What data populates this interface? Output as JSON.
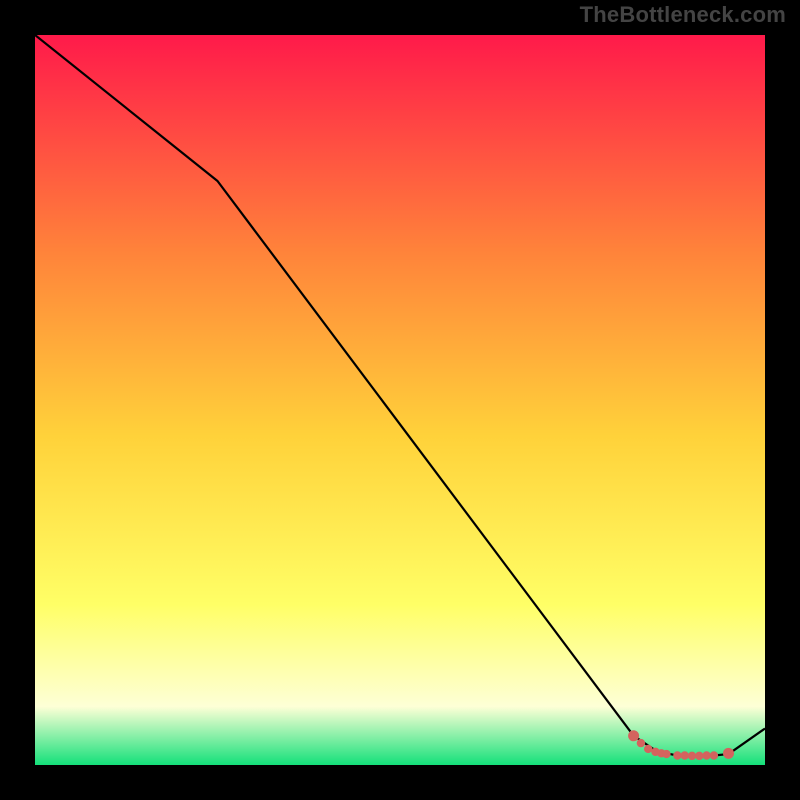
{
  "watermark": "TheBottleneck.com",
  "colors": {
    "gradient_top": "#ff1a4a",
    "gradient_mid_upper": "#ff843a",
    "gradient_mid": "#ffd23a",
    "gradient_mid_lower": "#ffff66",
    "gradient_lower": "#fdffd6",
    "gradient_bottom": "#14e07a",
    "line": "#000000",
    "marker": "#d4635e",
    "background": "#000000"
  },
  "chart_data": {
    "type": "line",
    "title": "",
    "xlabel": "",
    "ylabel": "",
    "xlim": [
      0,
      100
    ],
    "ylim": [
      0,
      100
    ],
    "series": [
      {
        "name": "bottleneck-curve",
        "x": [
          0,
          25,
          82,
          85,
          87,
          88,
          89,
          90,
          91,
          92,
          93,
          95,
          100
        ],
        "y": [
          100,
          80,
          4,
          2,
          1.5,
          1.3,
          1.2,
          1.2,
          1.2,
          1.2,
          1.3,
          1.5,
          5
        ]
      }
    ],
    "markers": [
      {
        "x": 82.0,
        "y": 4.0
      },
      {
        "x": 83.0,
        "y": 3.0
      },
      {
        "x": 84.0,
        "y": 2.2
      },
      {
        "x": 85.0,
        "y": 1.8
      },
      {
        "x": 85.8,
        "y": 1.6
      },
      {
        "x": 86.5,
        "y": 1.5
      },
      {
        "x": 88.0,
        "y": 1.3
      },
      {
        "x": 89.0,
        "y": 1.3
      },
      {
        "x": 90.0,
        "y": 1.25
      },
      {
        "x": 91.0,
        "y": 1.25
      },
      {
        "x": 92.0,
        "y": 1.3
      },
      {
        "x": 93.0,
        "y": 1.3
      },
      {
        "x": 95.0,
        "y": 1.6
      }
    ]
  }
}
